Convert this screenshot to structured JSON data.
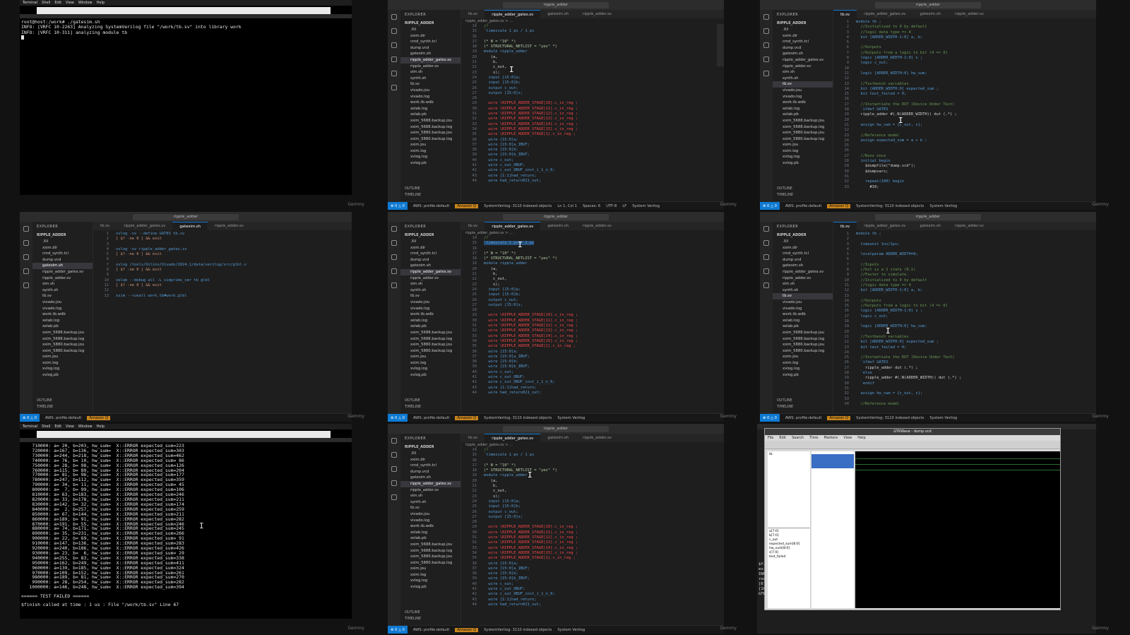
{
  "terminal_top": {
    "mac_menu": [
      "Terminal",
      "Shell",
      "Edit",
      "View",
      "Window",
      "Help"
    ],
    "lines": [
      "root@host:/work# ./gatesim.sh",
      "INFO: [VRFC 10-2263] Analyzing SystemVerilog file \"/work/tb.sv\" into library work",
      "INFO: [VRFC 10-311] analyzing module tb"
    ]
  },
  "terminal_bottom": {
    "lines": [
      "    710000: a= 20, b=203, hw_sum=  X::ERROR expected_sum=223",
      "    720000: a=167, b=136, hw_sum=  X::ERROR expected_sum=303",
      "    730000: a=244, b=218, hw_sum=  X::ERROR expected_sum=462",
      "    740000: a= 76, b= 10, hw_sum=  X::ERROR expected_sum= 86",
      "    750000: a= 28, b= 98, hw_sum=  X::ERROR expected_sum=126",
      "    760000: a=115, b= 89, hw_sum=  X::ERROR expected_sum=204",
      "    770000: a= 81, b= 96, hw_sum=  X::ERROR expected_sum=177",
      "    780000: a=247, b=112, hw_sum=  X::ERROR expected_sum=359",
      "    790000: a= 34, b= 11, hw_sum=  X::ERROR expected_sum= 45",
      "    800000: a=  7, b= 99, hw_sum=  X::ERROR expected_sum=106",
      "    810000: a= 63, b=183, hw_sum=  X::ERROR expected_sum=246",
      "    820000: a= 33, b=178, hw_sum=  X::ERROR expected_sum=211",
      "    830000: a=142, b= 32, hw_sum=  X::ERROR expected_sum=174",
      "    840000: a=  2, b=257, hw_sum=  X::ERROR expected_sum=259",
      "    850000: a= 67, b=144, hw_sum=  X::ERROR expected_sum=211",
      "    860000: a=189, b= 91, hw_sum=  X::ERROR expected_sum=282",
      "    870000: a=191, b= 55, hw_sum=  X::ERROR expected_sum=246",
      "    880000: a= 74, b=171, hw_sum=  X::ERROR expected_sum=245",
      "    890000: a= 35, b=231, hw_sum=  X::ERROR expected_sum=266",
      "    900000: a= 22, b= 69, hw_sum=  X::ERROR expected_sum= 91",
      "    910000: a=147, b=136, hw_sum=  X::ERROR expected_sum=283",
      "    920000: a=240, b=186, hw_sum=  X::ERROR expected_sum=426",
      "    930000: a= 23, b=  6, hw_sum=  X::ERROR expected_sum= 29",
      "    940000: a=255, b= 83, hw_sum=  X::ERROR expected_sum=338",
      "    950000: a=162, b=249, hw_sum=  X::ERROR expected_sum=411",
      "    960000: a=139, b=185, hw_sum=  X::ERROR expected_sum=324",
      "    970000: a=109, b=152, hw_sum=  X::ERROR expected_sum=261",
      "    980000: a=189, b= 81, hw_sum=  X::ERROR expected_sum=270",
      "    990000: a= 28, b=254, hw_sum=  X::ERROR expected_sum=282",
      "   1000000: a=146, b=248, hw_sum=  X::ERROR expected_sum=394"
    ],
    "failed": "====== TEST FAILED ======",
    "finish": "$finish called at time : 1 us : File \"/work/tb.sv\" Line 67"
  },
  "vscode": {
    "search": "ripple_adder",
    "explorer_label": "EXPLORER",
    "project": "RIPPLE_ADDER",
    "files": [
      ".Xil",
      "xsim.dir",
      "cmd_synth.tcl",
      "dump.vcd",
      "gatesim.sh",
      "ripple_adder_gates.sv",
      "ripple_adder.sv",
      "sim.sh",
      "synth.sh",
      "tb.sv",
      "vivado.jou",
      "vivado.log",
      "work.tb.wdb",
      "xelab.log",
      "xelab.pb",
      "xsim_5688.backup.jou",
      "xsim_5688.backup.log",
      "xsim_5880.backup.jou",
      "xsim_5880.backup.log",
      "xsim.jou",
      "xsim.log",
      "xvlog.log",
      "xvlog.pb"
    ],
    "outline": "OUTLINE",
    "timeline": "TIMELINE",
    "tabs": [
      "tb.sv",
      "ripple_adder_gates.sv",
      "gatesim.sh",
      "ripple_adder.sv"
    ],
    "crumb": "ripple_adder_gates.sv > ...",
    "status": {
      "remote": "⊗ 0 △ 0",
      "aws": "AWS: profile:default",
      "q": "Amazon Q",
      "index": "SystemVerilog: 3110 indexed objects",
      "pos": "Ln 1, Col 1",
      "spaces": "Spaces: 6",
      "enc": "UTF-8",
      "eol": "LF",
      "lang": "System Verilog"
    }
  },
  "gates_code": [
    "//",
    "`timescale 1 ps / 1 ps",
    "",
    "(* N = \"10\" *)",
    "(* STRUCTURAL_NETLIST = \"yes\" *)",
    "module ripple_adder",
    "   (a,",
    "    b,",
    "    c_out,",
    "    s);",
    "  input [15:0]a;",
    "  input [15:0]b;",
    "  output c_out;",
    "  output [15:0]s;",
    "",
    "  wire \\RIPPLE_ADDER_STAGE[10].c_in_reg ;",
    "  wire \\RIPPLE_ADDER_STAGE[11].c_in_reg ;",
    "  wire \\RIPPLE_ADDER_STAGE[12].c_in_reg ;",
    "  wire \\RIPPLE_ADDER_STAGE[13].c_in_reg ;",
    "  wire \\RIPPLE_ADDER_STAGE[14].c_in_reg ;",
    "  wire \\RIPPLE_ADDER_STAGE[15].c_in_reg ;",
    "  wire \\RIPPLE_ADDER_STAGE[1].c_in_reg ;",
    "  wire [15:0]a;",
    "  wire [15:0]a_IBUF;",
    "  wire [15:0]b;",
    "  wire [15:0]b_IBUF;",
    "  wire c_out;",
    "  wire c_out_OBUF;",
    "  wire c_out_OBUF_inst_i_1_n_0;",
    "  wire [1:1]had_return;",
    "  wire had_return021_out;"
  ],
  "tb_code": [
    "module tb ;",
    "  //Initialized to 0 by default",
    "  //logic data type => 4",
    "  bit [ADDER_WIDTH-1:0] a, b;",
    "",
    "  //Outputs",
    "  //Outputs from a logic to bit (4 => 0)",
    "  logic [ADDER_WIDTH-1:0] s ;",
    "  logic c_out;",
    "",
    "  logic [ADDER_WIDTH:0] hw_sum;",
    "",
    "  //Testbench variables",
    "  bit [ADDER_WIDTH:0] expected_sum ;",
    "  bit test_failed = 0;",
    "",
    "  //Instantiate the DUT (Device Under Test)",
    "  `ifdef GATES",
    "  ripple_adder #(.N(ADDER_WIDTH)) dut (.*) ;",
    "",
    "  assign hw_sum = {c_out, s};",
    "",
    "  //Reference model",
    "  assign expected_sum = a + b ;",
    "",
    "",
    "  //Runs once",
    "  initial begin",
    "    $dumpfile(\"dump.vcd\");",
    "    $dumpvars;",
    "",
    "    repeat(100) begin",
    "      #10;"
  ],
  "tb_code2": [
    "module tb ;",
    "",
    "  timeunit 1ns/1ps;",
    "",
    "  localparam ADDER_WIDTH=8;",
    "",
    "  //Inputs",
    "  //bit is a 2 state (0,1)",
    "  //Faster to simulate.",
    "  //Initialized to 0 by default",
    "  //logic data type => 4",
    "  bit [ADDER_WIDTH-1:0] a, b;",
    "",
    "  //Outputs",
    "  //Outputs from a logic to bit (4 => 0)",
    "  logic [ADDER_WIDTH-1:0] s ;",
    "  logic c_out;",
    "",
    "  logic [ADDER_WIDTH:0] hw_sum;",
    "",
    "  //Testbench variables",
    "  bit [ADDER_WIDTH:0] expected_sum ;",
    "  bit test_failed = 0;",
    "",
    "  //Instantiate the DUT (Device Under Test)",
    "  `ifdef GATES",
    "    ripple_adder dut (.*) ;",
    "  `else",
    "    ripple_adder #(.N(ADDER_WIDTH)) dut (.*) ;",
    "  `endif",
    "",
    "  assign hw_sum = {c_out, s};",
    "",
    "  //Reference model"
  ],
  "gatesim_code": [
    "xvlog -sv --define GATES tb.sv",
    "[ $? -ne 0 ] && exit",
    "",
    "xvlog -sv ripple_adder_gates.sv",
    "[ $? -ne 0 ] && exit",
    "",
    "xvlog /tools/Xilinx/Vivado/2024.1/data/verilog/src/glbl.v",
    "[ $? -ne 0 ] && exit",
    "",
    "xelab --debug all -L simprims_ver tb glbl",
    "[ $? -ne 0 ] && exit",
    "",
    "xsim --runall work.tb#work.glbl"
  ],
  "gtkwave": {
    "title": "GTKWave - dump.vcd",
    "menu": [
      "File",
      "Edit",
      "Search",
      "Time",
      "Markers",
      "View",
      "Help"
    ],
    "signals": [
      "a[7:0]",
      "b[7:0]",
      "c_out",
      "expected_sum[8:0]",
      "hw_sum[8:0]",
      "s[7:0]",
      "test_failed"
    ],
    "terminal_tail": [
      "$finis",
      "exit",
      "INFO:",
      "root@",
      "[0] st",
      "[1008",
      "GTKWAV"
    ]
  },
  "gemmy": "Gemmy"
}
